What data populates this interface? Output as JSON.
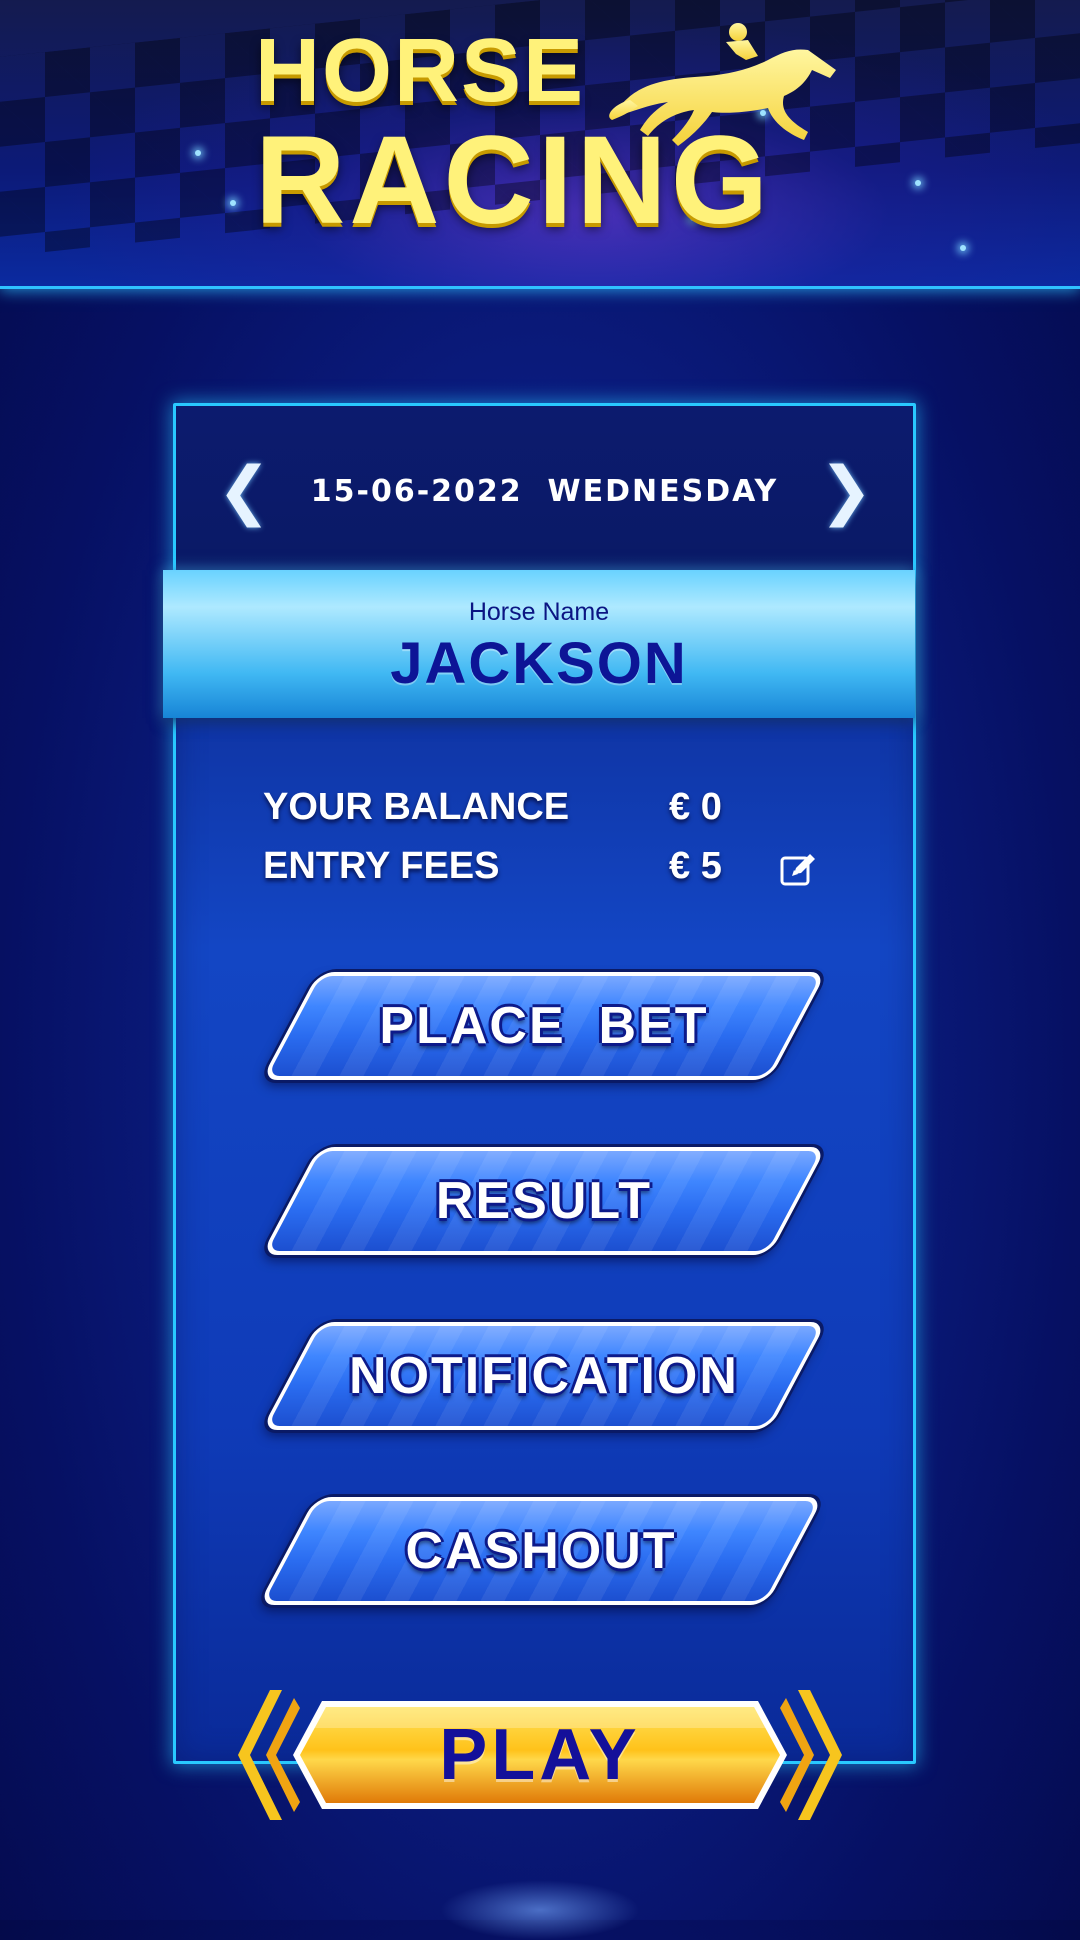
{
  "app": {
    "title_line1": "HORSE",
    "title_line2": "RACING"
  },
  "date_bar": {
    "prev_icon": "chevron-left-icon",
    "next_icon": "chevron-right-icon",
    "date": "15-06-2022",
    "weekday": "WEDNESDAY",
    "display": "15-06-2022  WEDNESDAY"
  },
  "horse": {
    "label": "Horse Name",
    "name": "JACKSON"
  },
  "account": {
    "balance_label": "YOUR BALANCE",
    "balance_value": "€ 0",
    "fees_label": "ENTRY FEES",
    "fees_value": "€ 5",
    "edit_icon": "edit-icon"
  },
  "menu": {
    "place_bet": "PLACE  BET",
    "result": "RESULT",
    "notification": "NOTIFICATION",
    "cashout": "CASHOUT"
  },
  "play": {
    "label": "PLAY"
  },
  "colors": {
    "accent_cyan": "#29c9ff",
    "logo_yellow": "#fff27a",
    "play_orange": "#f59a10",
    "button_blue": "#2a6cf0",
    "background_navy": "#061063"
  }
}
